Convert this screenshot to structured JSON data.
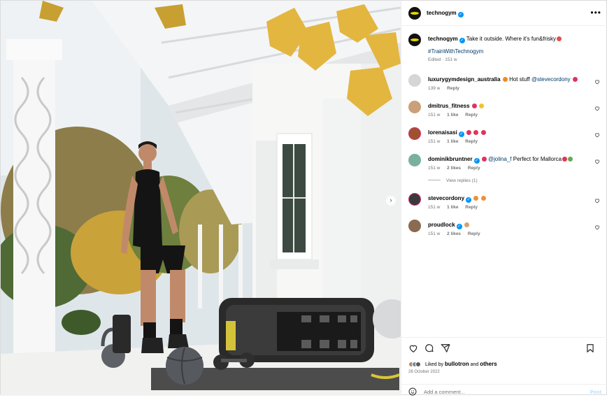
{
  "post": {
    "username": "technogym",
    "caption": "Take it outside. Where it's fun&frisky",
    "hashtag": "#TrainWithTechnogym",
    "edited": "Edited · 151 w"
  },
  "comments": [
    {
      "user": "luxurygymdesign_australia",
      "text_pre": "Hot stuff",
      "mention": "@stevecordony",
      "time": "139 w",
      "likes": "",
      "reply": "Reply",
      "avatar_color": "#d6d6d6"
    },
    {
      "user": "dmitrus_fitness",
      "text_pre": "",
      "mention": "",
      "time": "151 w",
      "likes": "1 like",
      "reply": "Reply",
      "avatar_color": "#c9a07a"
    },
    {
      "user": "lorenaisasi",
      "text_pre": "",
      "mention": "",
      "time": "151 w",
      "likes": "1 like",
      "reply": "Reply",
      "avatar_color": "#a0522d"
    },
    {
      "user": "dominikbruntner",
      "text_pre": "",
      "mention": "@jolina_f",
      "text_post": "Perfect for Mallorca",
      "time": "151 w",
      "likes": "2 likes",
      "reply": "Reply",
      "avatar_color": "#7ab0a0"
    },
    {
      "user": "stevecordony",
      "text_pre": "",
      "mention": "",
      "time": "151 w",
      "likes": "1 like",
      "reply": "Reply",
      "avatar_color": "#3a3a3a"
    },
    {
      "user": "proudlock",
      "text_pre": "",
      "mention": "",
      "time": "151 w",
      "likes": "2 likes",
      "reply": "Reply",
      "avatar_color": "#8a6a50"
    }
  ],
  "view_replies": "View replies (1)",
  "likes": {
    "prefix": "Liked by",
    "user": "bullotron",
    "and": "and",
    "others": "others"
  },
  "date": "26 October 2022",
  "add_comment": {
    "placeholder": "Add a comment...",
    "post": "Post"
  },
  "colors": {
    "verified": "#0095f6",
    "link": "#00376b",
    "muted": "#737373",
    "brand_yellow": "#e4d400"
  },
  "icons": [
    "heart-icon",
    "comment-icon",
    "share-icon",
    "bookmark-icon",
    "emoji-icon",
    "more-icon",
    "verified-icon",
    "chevron-right-icon"
  ]
}
